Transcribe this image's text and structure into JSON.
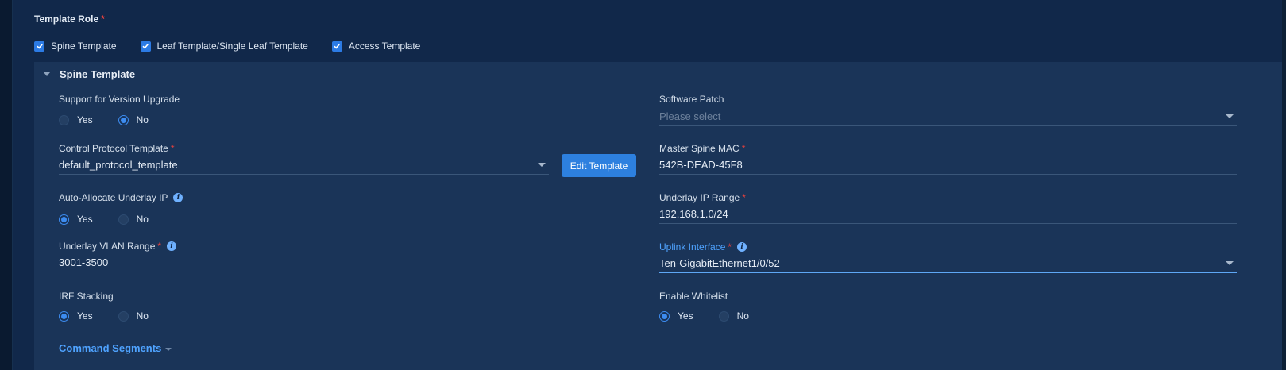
{
  "template_role": {
    "label": "Template Role",
    "required": "*",
    "options": [
      {
        "label": "Spine Template",
        "checked": true
      },
      {
        "label": "Leaf Template/Single Leaf Template",
        "checked": true
      },
      {
        "label": "Access Template",
        "checked": true
      }
    ]
  },
  "section": {
    "title": "Spine Template",
    "version_upgrade": {
      "label": "Support for Version Upgrade",
      "yes": "Yes",
      "no": "No",
      "selected": "No"
    },
    "software_patch": {
      "label": "Software Patch",
      "placeholder": "Please select"
    },
    "control_protocol": {
      "label": "Control Protocol Template",
      "required": "*",
      "value": "default_protocol_template",
      "edit_button": "Edit Template"
    },
    "master_spine_mac": {
      "label": "Master Spine MAC",
      "required": "*",
      "value": "542B-DEAD-45F8"
    },
    "auto_allocate": {
      "label": "Auto-Allocate Underlay IP",
      "info_icon": "info-icon",
      "yes": "Yes",
      "no": "No",
      "selected": "Yes"
    },
    "underlay_ip_range": {
      "label": "Underlay IP Range",
      "required": "*",
      "value": "192.168.1.0/24"
    },
    "underlay_vlan": {
      "label": "Underlay VLAN Range",
      "required": "*",
      "info_icon": "info-icon",
      "value": "3001-3500"
    },
    "uplink_interface": {
      "label": "Uplink Interface",
      "required": "*",
      "info_icon": "info-icon",
      "value": "Ten-GigabitEthernet1/0/52"
    },
    "irf_stacking": {
      "label": "IRF Stacking",
      "yes": "Yes",
      "no": "No",
      "selected": "Yes"
    },
    "enable_whitelist": {
      "label": "Enable Whitelist",
      "yes": "Yes",
      "no": "No",
      "selected": "Yes"
    },
    "command_segments": {
      "label": "Command Segments"
    }
  },
  "colors": {
    "background": "#0f2340",
    "section_bg": "#1a3458",
    "accent": "#2d80df",
    "link": "#4fa3ff",
    "required": "#e8413d"
  }
}
